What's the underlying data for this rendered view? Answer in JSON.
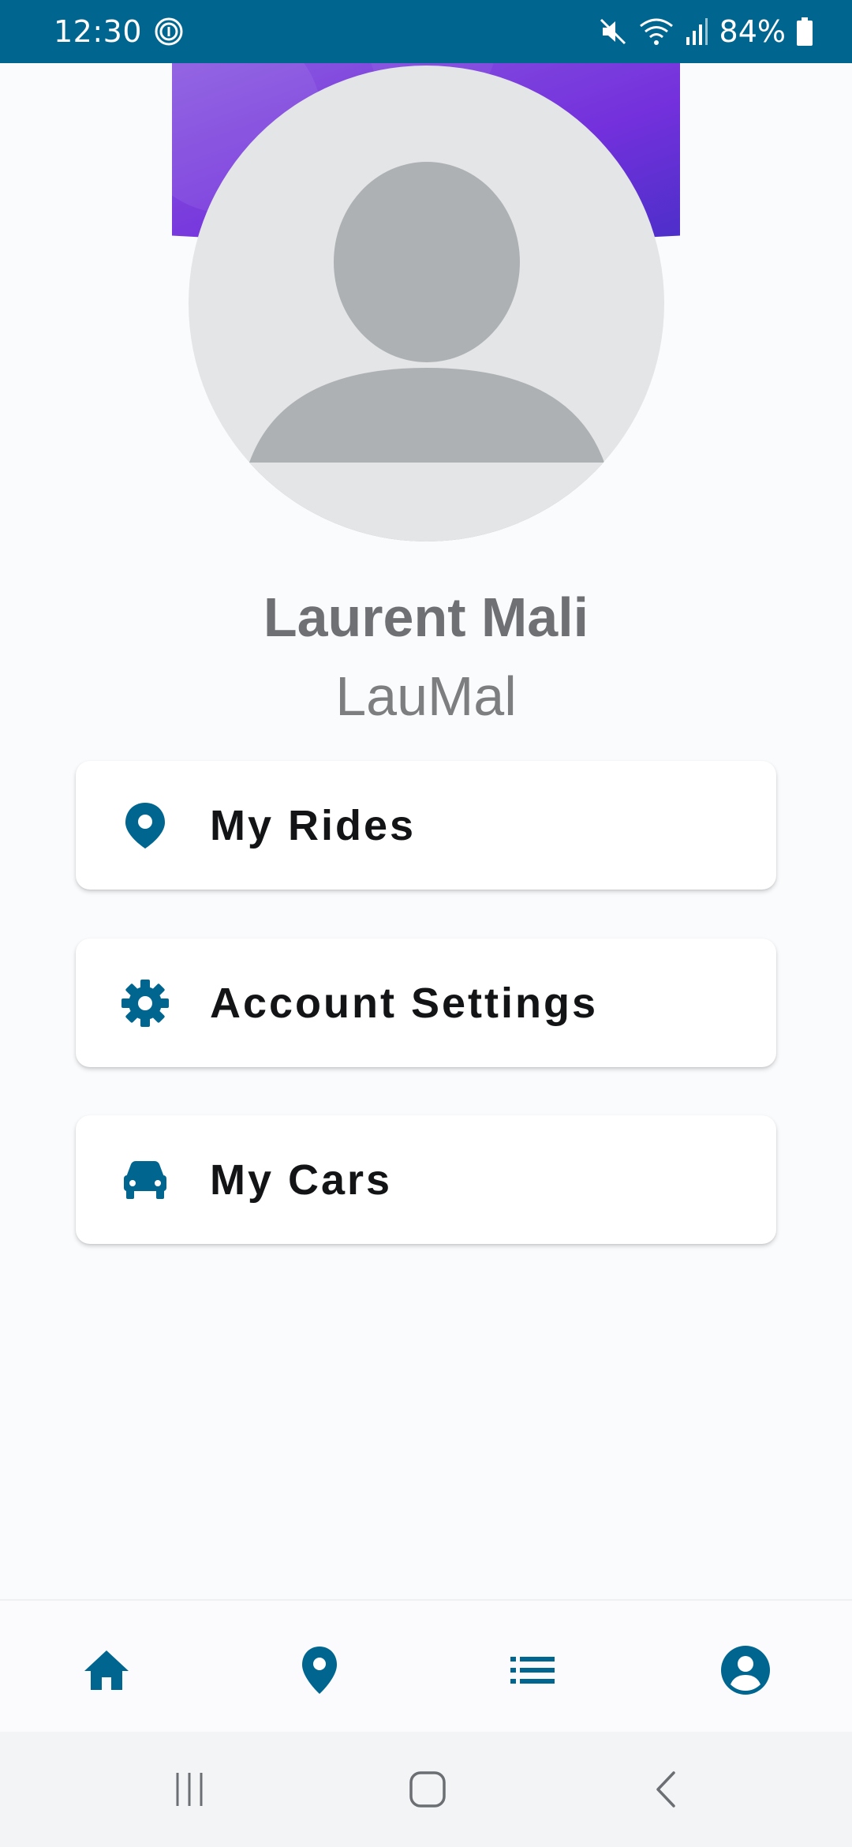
{
  "status_bar": {
    "time": "12:30",
    "battery_percent": "84%",
    "icons": [
      "vpn-ring-icon",
      "mute-icon",
      "wifi-icon",
      "signal-icon",
      "battery-icon"
    ]
  },
  "profile": {
    "full_name": "Laurent Mali",
    "username": "LauMal",
    "avatar_icon": "default-person-icon"
  },
  "menu": [
    {
      "label": "My Rides",
      "icon": "location-pin-icon"
    },
    {
      "label": "Account Settings",
      "icon": "gear-icon"
    },
    {
      "label": "My Cars",
      "icon": "car-icon"
    }
  ],
  "bottom_nav": {
    "items": [
      {
        "icon": "home-icon"
      },
      {
        "icon": "location-pin-icon"
      },
      {
        "icon": "list-icon"
      },
      {
        "icon": "account-circle-icon"
      }
    ]
  },
  "system_nav": {
    "items": [
      {
        "icon": "recent-apps-icon"
      },
      {
        "icon": "home-button-icon"
      },
      {
        "icon": "back-icon"
      }
    ]
  },
  "colors": {
    "status_bar_bg": "#00668f",
    "accent": "#00668f",
    "banner_gradient_start": "#8b5ae0",
    "banner_gradient_end": "#5a2fd6",
    "background": "#fafbfd",
    "card_bg": "#ffffff",
    "avatar_bg": "#e4e5e7",
    "avatar_figure": "#aeb1b4"
  }
}
